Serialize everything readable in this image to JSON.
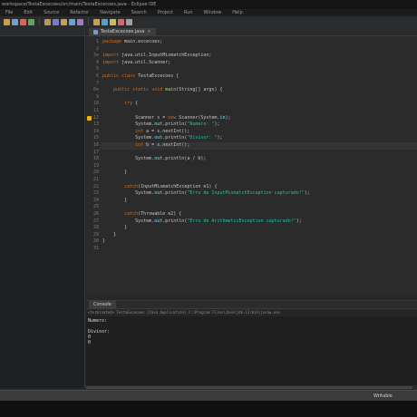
{
  "window": {
    "title": "workspace/TestaExcecoes/src/main/TestaExcecoes.java - Eclipse IDE"
  },
  "menubar": [
    "File",
    "Edit",
    "Source",
    "Refactor",
    "Navigate",
    "Search",
    "Project",
    "Run",
    "Window",
    "Help"
  ],
  "toolbar": {
    "icon_colors": [
      "#c8a04a",
      "#6a9fd8",
      "#d06a5a",
      "#5aa85a",
      "#b89a56",
      "#7a7ac0",
      "#c8a04a",
      "#6aa0d0",
      "#a07ad0",
      "#d0a040",
      "#5aa0c0",
      "#c8c050",
      "#d06a6a",
      "#a0a0a0"
    ]
  },
  "editor": {
    "tab_label": "TestaExcecoes.java",
    "lines": [
      {
        "n": "1",
        "html": "<span class='kw'>package</span> main.excecoes;"
      },
      {
        "n": "2",
        "html": ""
      },
      {
        "n": "3⊖",
        "html": "<span class='kw'>import</span> java.util.InputMismatchException;"
      },
      {
        "n": "4",
        "html": "<span class='kw'>import</span> java.util.Scanner;"
      },
      {
        "n": "5",
        "html": ""
      },
      {
        "n": "6",
        "html": "<span class='kw'>public class</span> TestaExcecoes {"
      },
      {
        "n": "7",
        "html": ""
      },
      {
        "n": "8⊖",
        "html": "    <span class='kw'>public static void</span> <span class='fn'>main</span>(String[] args) {"
      },
      {
        "n": "9",
        "html": ""
      },
      {
        "n": "10",
        "html": "        <span class='kw'>try</span> {"
      },
      {
        "n": "11",
        "html": ""
      },
      {
        "n": "12",
        "html": "            Scanner s = <span class='kw'>new</span> Scanner(System.<span class='fd'>in</span>);"
      },
      {
        "n": "13",
        "html": "            System.<span class='fd'>out</span>.println(<span class='st'>\"Numero: \"</span>);"
      },
      {
        "n": "14",
        "html": "            <span class='kw'>int</span> a = s.nextInt();"
      },
      {
        "n": "15",
        "html": "            System.<span class='fd'>out</span>.println(<span class='st'>\"Divisor: \"</span>);"
      },
      {
        "n": "16",
        "html": "            <span class='kw'>int</span> b = s.nextInt();"
      },
      {
        "n": "17",
        "html": ""
      },
      {
        "n": "18",
        "html": "            System.<span class='fd'>out</span>.println(a / b);"
      },
      {
        "n": "19",
        "html": ""
      },
      {
        "n": "20",
        "html": "        }"
      },
      {
        "n": "21",
        "html": ""
      },
      {
        "n": "22",
        "html": "        <span class='kw'>catch</span>(InputMismatchException e1) {"
      },
      {
        "n": "23",
        "html": "            System.<span class='fd'>out</span>.println(<span class='st'>\"Erro de InputMismatchException capturado!\"</span>);"
      },
      {
        "n": "24",
        "html": "        }"
      },
      {
        "n": "25",
        "html": ""
      },
      {
        "n": "26",
        "html": "        <span class='kw'>catch</span>(Throwable e2) {"
      },
      {
        "n": "27",
        "html": "            System.<span class='fd'>out</span>.println(<span class='st'>\"Erro de ArithmeticException capturado!\"</span>);"
      },
      {
        "n": "28",
        "html": "        }"
      },
      {
        "n": "29",
        "html": "    }"
      },
      {
        "n": "30",
        "html": "}"
      },
      {
        "n": "31",
        "html": ""
      }
    ]
  },
  "console": {
    "tab_label": "Console",
    "path": "<terminated> TestaExcecoes [Java Application] C:\\Program Files\\Java\\jdk-11\\bin\\javaw.exe",
    "output": [
      "Numero:",
      "",
      "Divisor:",
      "0",
      "0"
    ]
  },
  "statusbar": {
    "right_text": "Writable"
  }
}
